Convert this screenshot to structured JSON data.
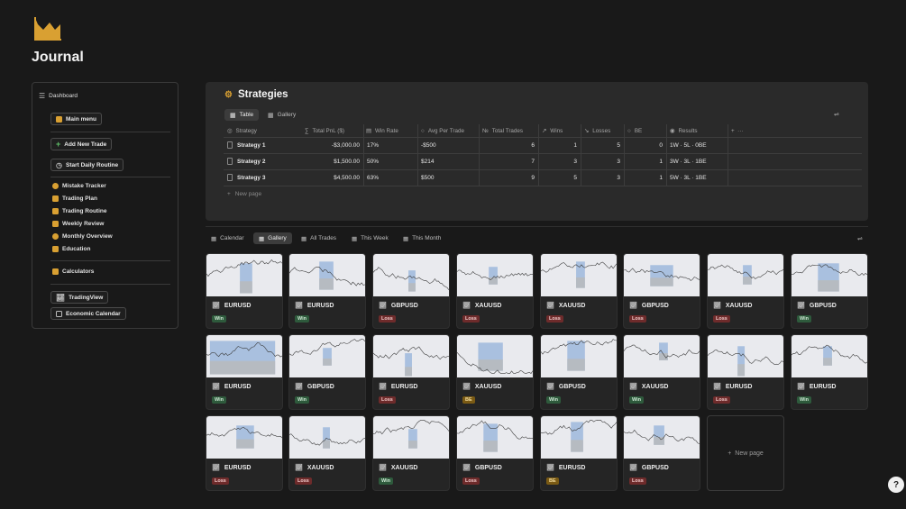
{
  "page": {
    "title": "Journal"
  },
  "sidebar": {
    "dashboard": "Dashboard",
    "main_menu": "Main menu",
    "add_trade": "Add New Trade",
    "daily_routine": "Start Daily Routine",
    "links": [
      "Mistake Tracker",
      "Trading Plan",
      "Trading Routine",
      "Weekly Review",
      "Monthly Overview",
      "Education"
    ],
    "calculators": "Calculators",
    "tradingview": "TradingView",
    "economic_calendar": "Economic Calendar"
  },
  "strategies": {
    "title": "Strategies",
    "tabs": [
      "Table",
      "Gallery"
    ],
    "columns": [
      "Strategy",
      "Total PnL ($)",
      "Win Rate",
      "Avg Per Trade",
      "Total Trades",
      "Wins",
      "Losses",
      "BE",
      "Results"
    ],
    "rows": [
      {
        "name": "Strategy 1",
        "pnl": "-$3,000.00",
        "winrate": "17%",
        "avg": "-$500",
        "trades": "6",
        "wins": "1",
        "losses": "5",
        "be": "0",
        "results": "1W · 5L · 0BE"
      },
      {
        "name": "Strategy 2",
        "pnl": "$1,500.00",
        "winrate": "50%",
        "avg": "$214",
        "trades": "7",
        "wins": "3",
        "losses": "3",
        "be": "1",
        "results": "3W · 3L · 1BE"
      },
      {
        "name": "Strategy 3",
        "pnl": "$4,500.00",
        "winrate": "63%",
        "avg": "$500",
        "trades": "9",
        "wins": "5",
        "losses": "3",
        "be": "1",
        "results": "5W · 3L · 1BE"
      }
    ],
    "new_page": "New page"
  },
  "views": {
    "tabs": [
      "Calendar",
      "Gallery",
      "All Trades",
      "This Week",
      "This Month"
    ],
    "active": "Gallery"
  },
  "gallery": {
    "cards": [
      {
        "pair": "EURUSD",
        "result": "Win"
      },
      {
        "pair": "EURUSD",
        "result": "Win"
      },
      {
        "pair": "GBPUSD",
        "result": "Loss"
      },
      {
        "pair": "XAUUSD",
        "result": "Loss"
      },
      {
        "pair": "XAUUSD",
        "result": "Loss"
      },
      {
        "pair": "GBPUSD",
        "result": "Loss"
      },
      {
        "pair": "XAUUSD",
        "result": "Loss"
      },
      {
        "pair": "GBPUSD",
        "result": "Win"
      },
      {
        "pair": "EURUSD",
        "result": "Win"
      },
      {
        "pair": "GBPUSD",
        "result": "Win"
      },
      {
        "pair": "EURUSD",
        "result": "Loss"
      },
      {
        "pair": "XAUUSD",
        "result": "BE"
      },
      {
        "pair": "GBPUSD",
        "result": "Win"
      },
      {
        "pair": "XAUUSD",
        "result": "Win"
      },
      {
        "pair": "EURUSD",
        "result": "Loss"
      },
      {
        "pair": "EURUSD",
        "result": "Win"
      },
      {
        "pair": "EURUSD",
        "result": "Loss"
      },
      {
        "pair": "XAUUSD",
        "result": "Loss"
      },
      {
        "pair": "XAUUSD",
        "result": "Win"
      },
      {
        "pair": "GBPUSD",
        "result": "Loss"
      },
      {
        "pair": "EURUSD",
        "result": "BE"
      },
      {
        "pair": "GBPUSD",
        "result": "Loss"
      }
    ],
    "new_page": "New page"
  },
  "colors": {
    "accent": "#d9a032",
    "win": "#2e5a3c",
    "loss": "#6e2b2b",
    "be": "#7a5a14"
  }
}
